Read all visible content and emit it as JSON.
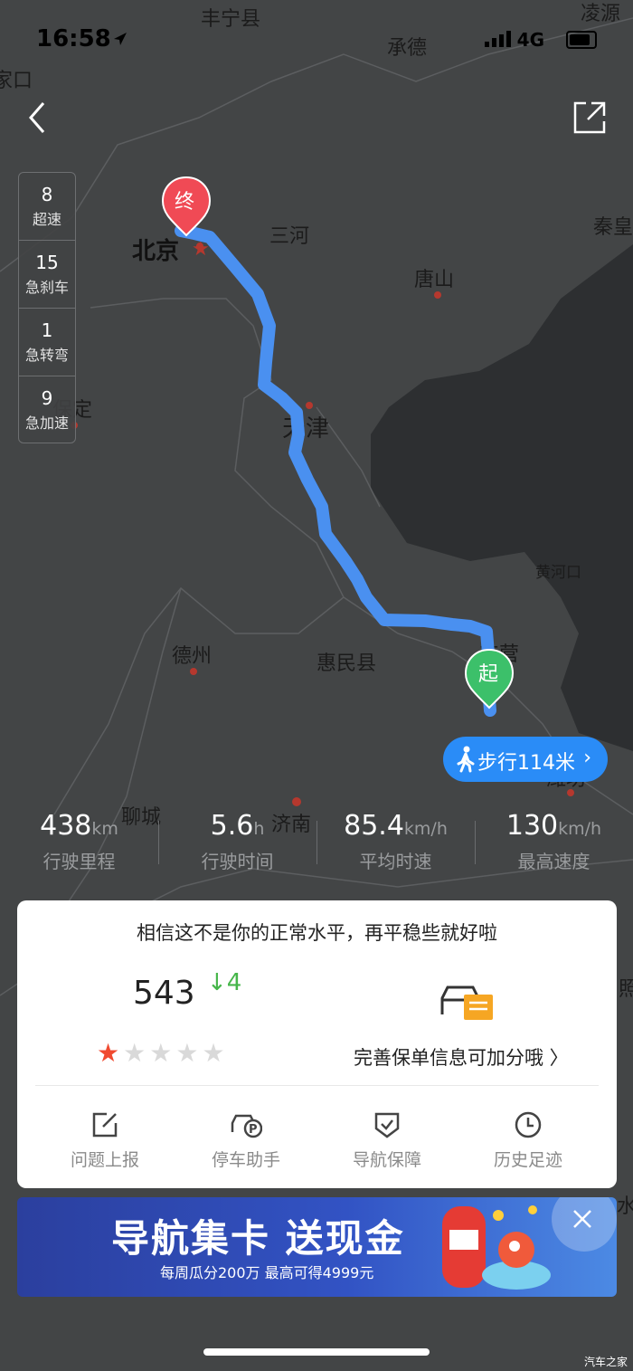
{
  "status_bar": {
    "time": "16:58",
    "network": "4G"
  },
  "map": {
    "labels": [
      "丰宁县",
      "凌源",
      "承德",
      "家口",
      "三河",
      "秦皇",
      "北京",
      "唐山",
      "保定",
      "天津",
      "黄河口",
      "德州",
      "惠民县",
      "东营",
      "聊城",
      "济南",
      "潍坊",
      "照",
      "水"
    ],
    "start_marker": "起",
    "end_marker": "终"
  },
  "events": [
    {
      "count": "8",
      "label": "超速"
    },
    {
      "count": "15",
      "label": "急刹车"
    },
    {
      "count": "1",
      "label": "急转弯"
    },
    {
      "count": "9",
      "label": "急加速"
    }
  ],
  "walk_button": {
    "label": "步行114米"
  },
  "metrics": [
    {
      "value": "438",
      "unit": "km",
      "label": "行驶里程"
    },
    {
      "value": "5.6",
      "unit": "h",
      "label": "行驶时间"
    },
    {
      "value": "85.4",
      "unit": "km/h",
      "label": "平均时速"
    },
    {
      "value": "130",
      "unit": "km/h",
      "label": "最高速度"
    }
  ],
  "card": {
    "message": "相信这不是你的正常水平，再平稳些就好啦",
    "score": "543",
    "delta": "↓4",
    "rating": 1,
    "rating_max": 5,
    "insurance_text": "完善保单信息可加分哦 〉",
    "actions": [
      {
        "label": "问题上报",
        "icon": "edit-icon"
      },
      {
        "label": "停车助手",
        "icon": "parking-car-icon"
      },
      {
        "label": "导航保障",
        "icon": "shield-check-icon"
      },
      {
        "label": "历史足迹",
        "icon": "clock-icon"
      }
    ]
  },
  "banner": {
    "title": "导航集卡 送现金",
    "subtitle": "每周瓜分200万  最高可得4999元"
  },
  "watermark": "汽车之家",
  "colors": {
    "route": "#4a90f0",
    "walk_button": "#2a8cf7",
    "star_active": "#f04a30",
    "delta": "#46b64a",
    "end_pin": "#f04a55",
    "start_pin": "#3cc06a"
  }
}
